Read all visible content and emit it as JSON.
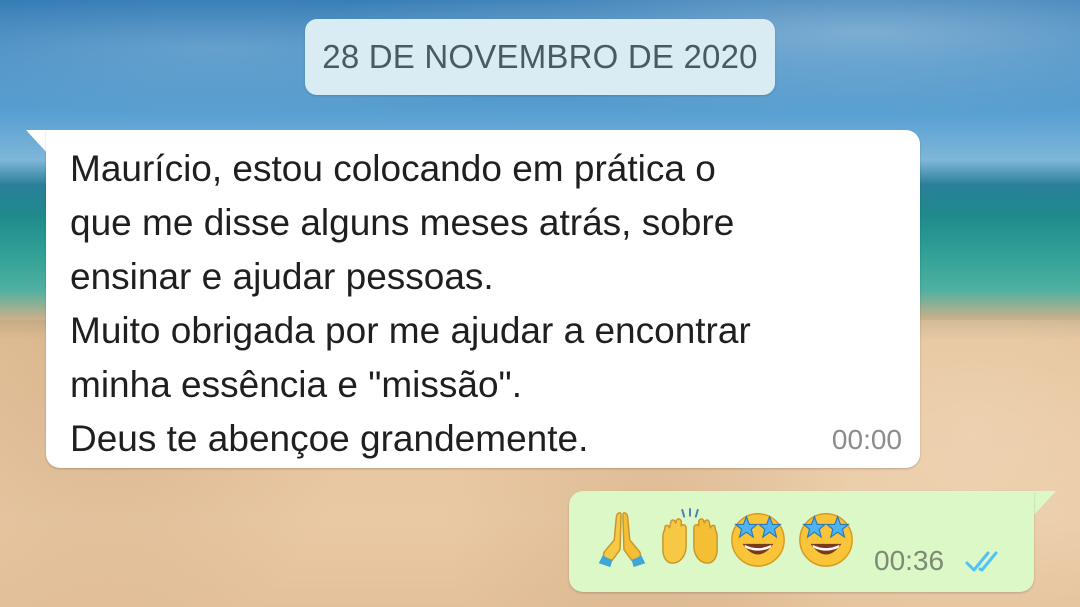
{
  "wallpaper": "beach",
  "date_chip": {
    "text": "28 DE NOVEMBRO DE 2020"
  },
  "incoming_message": {
    "lines": [
      "Maurício, estou colocando em prática o",
      "que me disse alguns meses atrás, sobre",
      "ensinar e ajudar pessoas.",
      "Muito obrigada por me ajudar a encontrar",
      "minha essência e \"missão\".",
      "Deus te abençoe grandemente."
    ],
    "time": "00:00"
  },
  "outgoing_message": {
    "emojis": [
      "folded-hands",
      "raising-hands",
      "star-struck",
      "star-struck"
    ],
    "time": "00:36",
    "status": "read",
    "status_color": "#4fc3f7"
  },
  "colors": {
    "incoming_bubble": "#ffffff",
    "outgoing_bubble": "#dcf8c6",
    "date_chip": "#d9ecf3"
  }
}
